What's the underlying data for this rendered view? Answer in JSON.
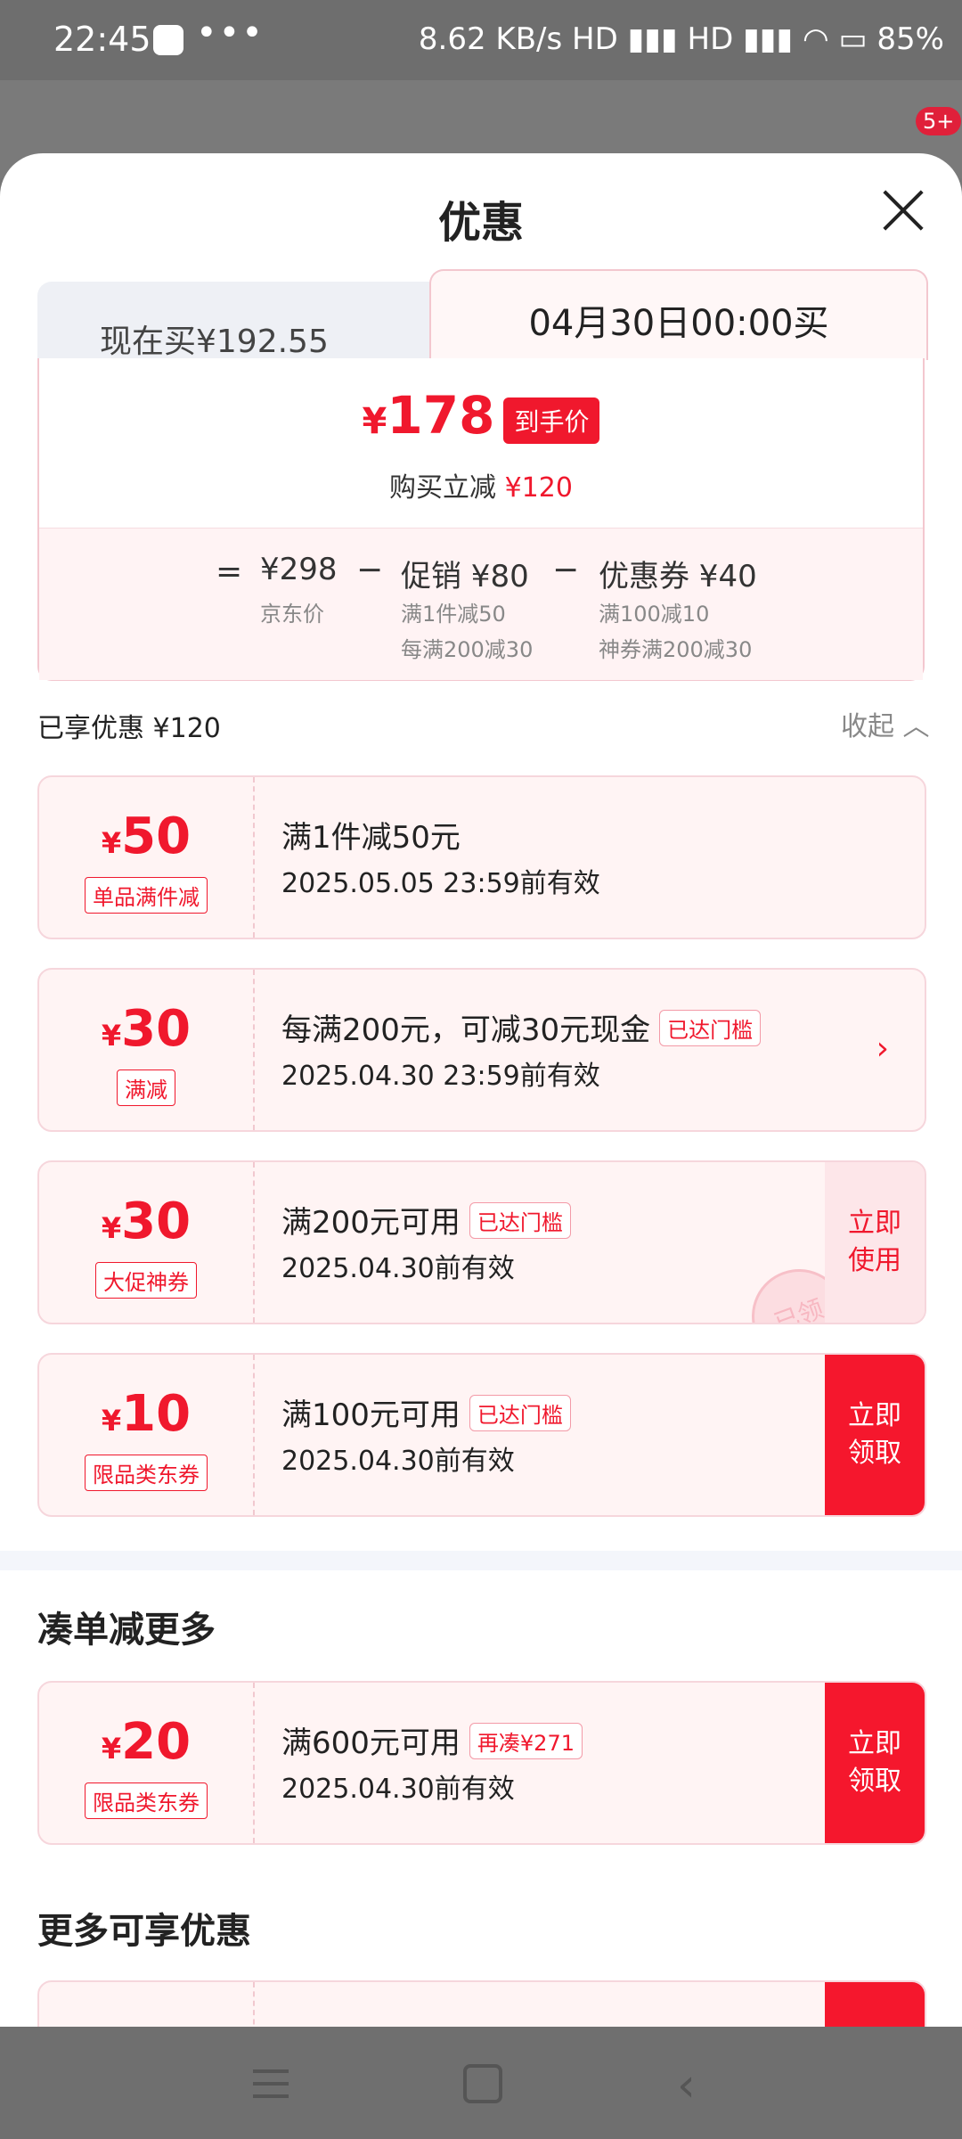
{
  "status_bar": {
    "time": "22:45",
    "more": "•••",
    "right": "8.62 KB/s HD ▮▮▮ HD ▮▮▮ ◠ ▭ 85%",
    "battery": "85%"
  },
  "background": {
    "badge": "5+"
  },
  "sheet": {
    "title": "优惠",
    "tabs": {
      "now": "现在买¥192.55",
      "future": "04月30日00:00买"
    },
    "final_price": {
      "yen": "¥",
      "value": "178",
      "tag": "到手价"
    },
    "instant_cut": {
      "label": "购买立减",
      "amount": "¥120"
    },
    "breakdown": {
      "equals": "=",
      "base": {
        "value": "¥298",
        "label": "京东价"
      },
      "minus1": "−",
      "promo": {
        "value": "促销 ¥80",
        "line1": "满1件减50",
        "line2": "每满200减30"
      },
      "minus2": "−",
      "coupon": {
        "value": "优惠券 ¥40",
        "line1": "满100减10",
        "line2": "神券满200减30"
      }
    },
    "enjoyed": "已享优惠 ¥120",
    "collapse": "收起 ︿"
  },
  "coupons": [
    {
      "yen": "¥",
      "amount": "50",
      "tag": "单品满件减",
      "title": "满1件减50元",
      "valid": "2025.05.05 23:59前有效"
    },
    {
      "yen": "¥",
      "amount": "30",
      "tag": "满减",
      "title": "每满200元，可减30元现金",
      "chip": "已达门槛",
      "valid": "2025.04.30 23:59前有效",
      "chevron": "›"
    },
    {
      "yen": "¥",
      "amount": "30",
      "tag": "大促神券",
      "title": "满200元可用",
      "chip": "已达门槛",
      "valid": "2025.04.30前有效",
      "button": "立即使用",
      "stamp": "已领"
    },
    {
      "yen": "¥",
      "amount": "10",
      "tag": "限品类东券",
      "title": "满100元可用",
      "chip": "已达门槛",
      "valid": "2025.04.30前有效",
      "button": "立即领取"
    }
  ],
  "section_more": {
    "title": "凑单减更多",
    "coupon": {
      "yen": "¥",
      "amount": "20",
      "tag": "限品类东券",
      "title": "满600元可用",
      "chip": "再凑¥271",
      "valid": "2025.04.30前有效",
      "button": "立即领取"
    }
  },
  "section_extra": {
    "title": "更多可享优惠"
  }
}
